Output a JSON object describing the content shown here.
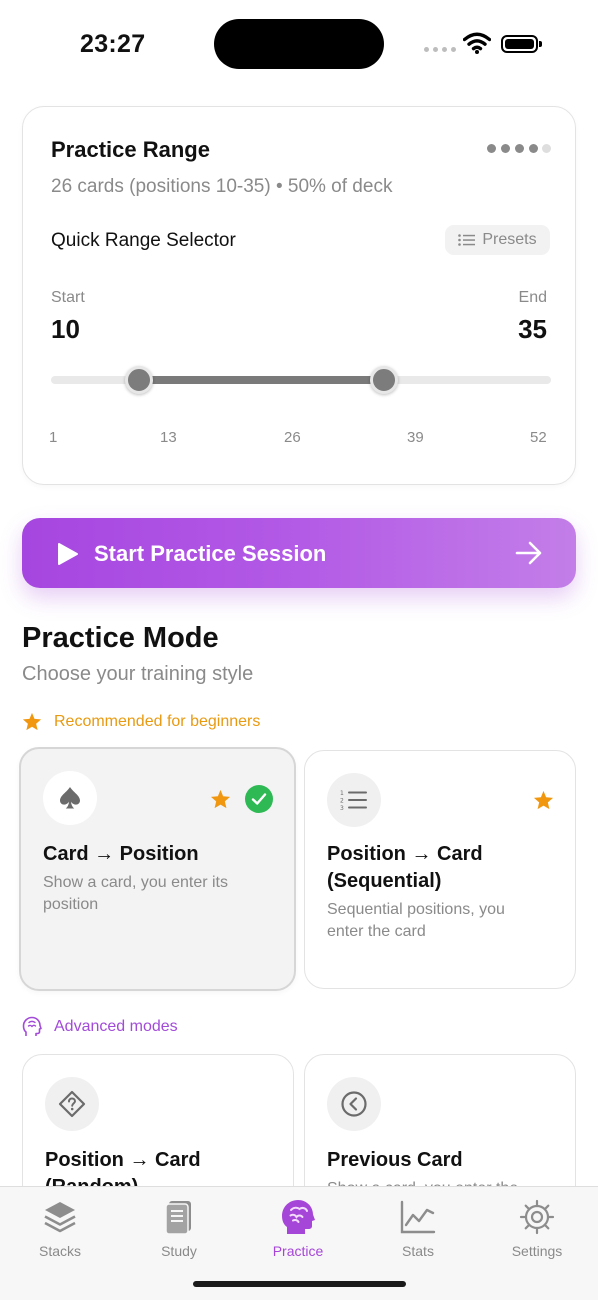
{
  "status": {
    "time": "23:27"
  },
  "range": {
    "title": "Practice Range",
    "subtitle": "26 cards (positions 10-35) • 50% of deck",
    "quick_label": "Quick Range Selector",
    "presets_label": "Presets",
    "start_label": "Start",
    "end_label": "End",
    "start_value": "10",
    "end_value": "35",
    "deck_min": 1,
    "deck_max": 52,
    "ticks": [
      "1",
      "13",
      "26",
      "39",
      "52"
    ]
  },
  "start_button": {
    "label": "Start Practice Session"
  },
  "practice_mode": {
    "title": "Practice Mode",
    "subtitle": "Choose your training style",
    "recommended_label": "Recommended for beginners",
    "advanced_label": "Advanced modes",
    "modes": [
      {
        "title": "Card → Position",
        "desc": "Show a card, you enter its position",
        "icon": "spade-icon",
        "recommended": true,
        "selected": true
      },
      {
        "title": "Position → Card (Sequential)",
        "desc": "Sequential positions, you enter the card",
        "icon": "numbered-list-icon",
        "recommended": true,
        "selected": false
      },
      {
        "title": "Position → Card (Random)",
        "desc": "",
        "icon": "question-diamond-icon",
        "recommended": false,
        "selected": false
      },
      {
        "title": "Previous Card",
        "desc": "Show a card, you enter the",
        "icon": "chevron-left-circle-icon",
        "recommended": false,
        "selected": false
      }
    ]
  },
  "tabs": [
    {
      "label": "Stacks",
      "icon": "stack-icon",
      "active": false
    },
    {
      "label": "Study",
      "icon": "book-icon",
      "active": false
    },
    {
      "label": "Practice",
      "icon": "brain-icon",
      "active": true
    },
    {
      "label": "Stats",
      "icon": "chart-icon",
      "active": false
    },
    {
      "label": "Settings",
      "icon": "gear-icon",
      "active": false
    }
  ],
  "colors": {
    "accent": "#a646d8",
    "recommended": "#e89a12",
    "selected_check": "#2fb955"
  }
}
